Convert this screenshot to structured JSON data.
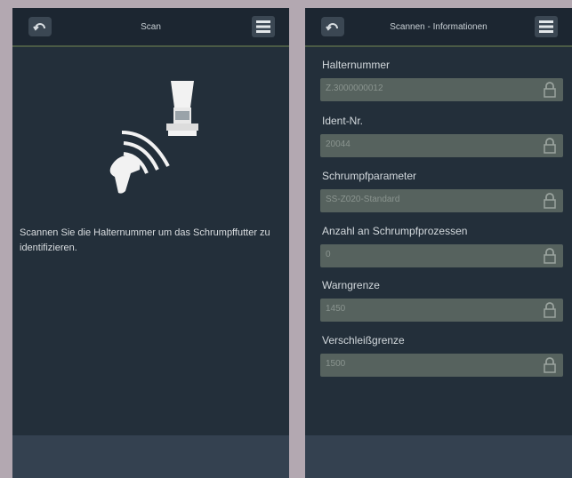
{
  "left_screen": {
    "title": "Scan",
    "instruction": "Scannen Sie die Halternummer um das Schrumpffutter zu identifizieren.",
    "icons": [
      "back-icon",
      "menu-icon",
      "scanner-icon",
      "tool-holder-icon"
    ]
  },
  "right_screen": {
    "title": "Scannen - Informationen",
    "fields": [
      {
        "label": "Halternummer",
        "value": "Z.3000000012"
      },
      {
        "label": "Ident-Nr.",
        "value": "20044"
      },
      {
        "label": "Schrumpfparameter",
        "value": "SS-Z020-Standard"
      },
      {
        "label": "Anzahl an Schrumpfprozessen",
        "value": "0"
      },
      {
        "label": "Warngrenze",
        "value": "1450"
      },
      {
        "label": "Verschleißgrenze",
        "value": "1500"
      }
    ],
    "icons": [
      "back-icon",
      "menu-icon",
      "lock-icon"
    ]
  },
  "colors": {
    "background": "#b3a8b1",
    "screen": "#232f3a",
    "header": "#1c2631",
    "field": "#56625e",
    "footer": "#344150"
  }
}
